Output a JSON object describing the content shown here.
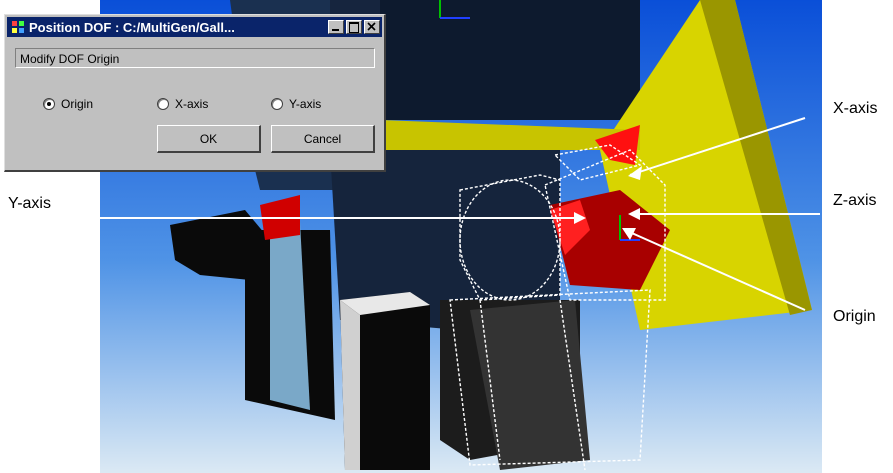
{
  "dialog": {
    "title": "Position DOF : C:/MultiGen/Gall...",
    "status_text": "Modify DOF Origin",
    "radios": [
      {
        "label": "Origin",
        "selected": true
      },
      {
        "label": "X-axis",
        "selected": false
      },
      {
        "label": "Y-axis",
        "selected": false
      }
    ],
    "ok_label": "OK",
    "cancel_label": "Cancel"
  },
  "callouts": {
    "x_axis": "X-axis",
    "y_axis": "Y-axis",
    "z_axis": "Z-axis",
    "origin": "Origin"
  },
  "colors": {
    "sky_top": "#0a4fd8",
    "sky_bottom": "#dbe9f4",
    "yellow": "#d8d400",
    "red": "#cc0000",
    "titlebar": "#0a246a",
    "dialog_face": "#c0c0c0"
  }
}
